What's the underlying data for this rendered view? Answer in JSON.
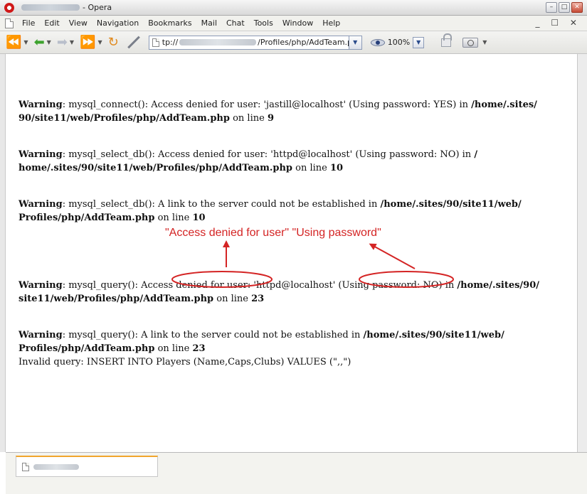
{
  "window": {
    "title_suffix": "- Opera"
  },
  "menu": [
    "File",
    "Edit",
    "View",
    "Navigation",
    "Bookmarks",
    "Mail",
    "Chat",
    "Tools",
    "Window",
    "Help"
  ],
  "mdi_controls": "_ ☐ ✕",
  "address": {
    "prefix": "tp://",
    "suffix": "/Profiles/php/AddTeam.ph"
  },
  "zoom": {
    "level": "100%"
  },
  "warnings": [
    {
      "line1": [
        "Warning",
        ": mysql_connect(): Access denied for user: 'jastill@localhost' (Using password: YES) in ",
        "/home/.sites/"
      ],
      "line2": [
        "90/site11/web/Profiles/php/AddTeam.php",
        " on line ",
        "9"
      ]
    },
    {
      "line1": [
        "Warning",
        ": mysql_select_db(): Access denied for user: 'httpd@localhost' (Using password: NO) in ",
        "/"
      ],
      "line2": [
        "home/.sites/90/site11/web/Profiles/php/AddTeam.php",
        " on line ",
        "10"
      ]
    },
    {
      "line1": [
        "Warning",
        ": mysql_select_db(): A link to the server could not be established in ",
        "/home/.sites/90/site11/web/"
      ],
      "line2": [
        "Profiles/php/AddTeam.php",
        " on line ",
        "10"
      ]
    },
    {
      "line1": [
        "Warning",
        ": mysql_query(): Access denied for user: 'httpd@localhost' (Using password: NO) in ",
        "/home/.sites/90/"
      ],
      "line2": [
        "site11/web/Profiles/php/AddTeam.php",
        " on line ",
        "23"
      ]
    },
    {
      "line1": [
        "Warning",
        ": mysql_query(): A link to the server could not be established in ",
        "/home/.sites/90/site11/web/"
      ],
      "line2": [
        "Profiles/php/AddTeam.php",
        " on line ",
        "23"
      ],
      "line3": "Invalid query: INSERT INTO Players (Name,Caps,Clubs) VALUES (\",,\")"
    }
  ],
  "annotation": {
    "label": "\"Access denied for user\" \"Using password\"",
    "color": "#d42424"
  }
}
